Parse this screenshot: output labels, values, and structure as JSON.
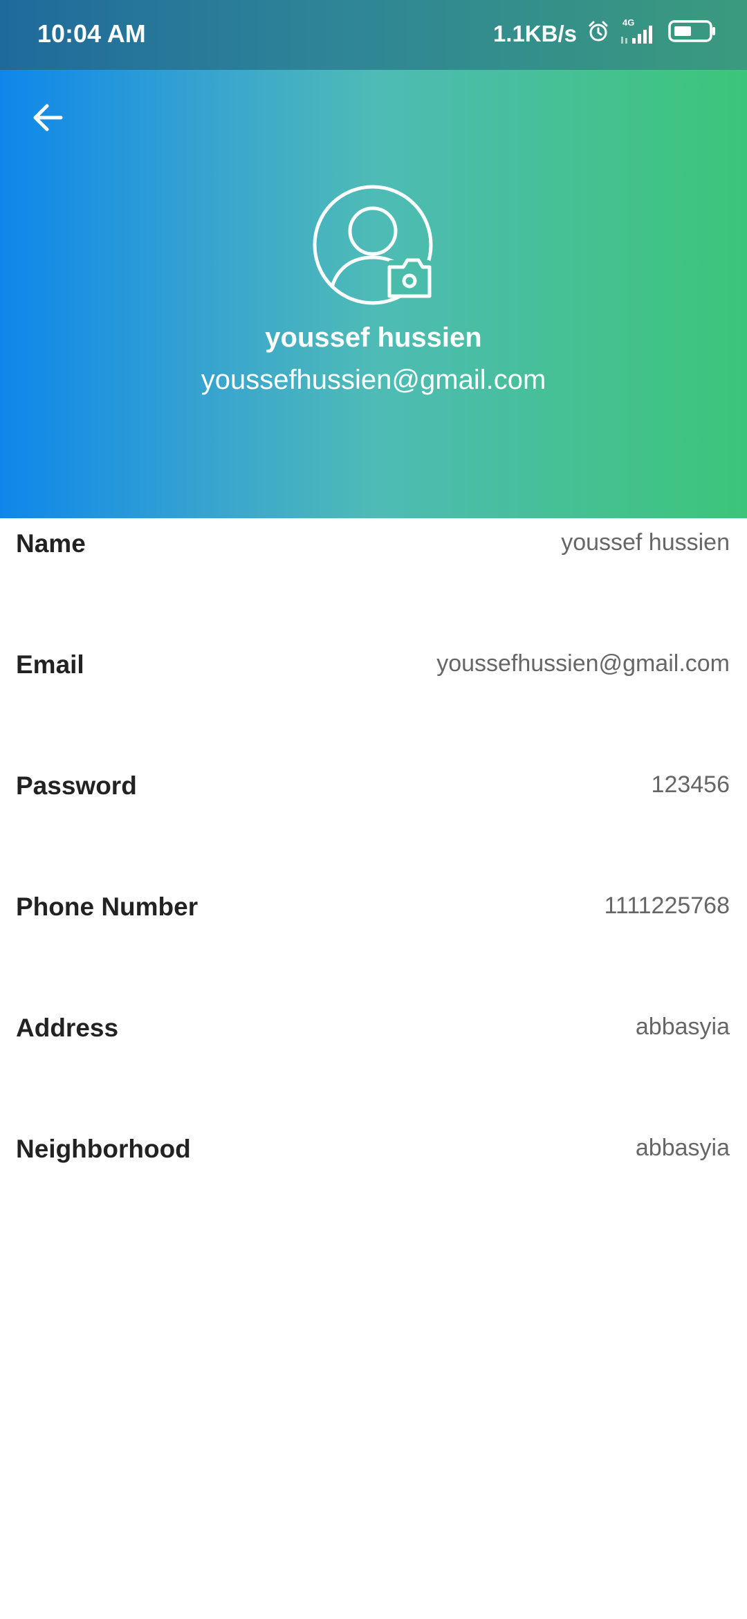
{
  "status_bar": {
    "time": "10:04 AM",
    "network_speed": "1.1KB/s",
    "network_type": "4G",
    "icons": [
      "alarm-icon",
      "signal-icon",
      "battery-icon"
    ]
  },
  "header": {
    "back_icon": "arrow-left-icon",
    "avatar_icon": "user-camera-icon",
    "name": "youssef hussien",
    "email": "youssefhussien@gmail.com",
    "gradient_colors": [
      "#0e87ea",
      "#4ebbb6",
      "#3cc57a"
    ]
  },
  "info": [
    {
      "label": "Name",
      "value": "youssef hussien"
    },
    {
      "label": "Email",
      "value": "youssefhussien@gmail.com"
    },
    {
      "label": "Password",
      "value": "123456"
    },
    {
      "label": "Phone Number",
      "value": "1111225768"
    },
    {
      "label": "Address",
      "value": "abbasyia"
    },
    {
      "label": "Neighborhood",
      "value": "abbasyia"
    }
  ]
}
